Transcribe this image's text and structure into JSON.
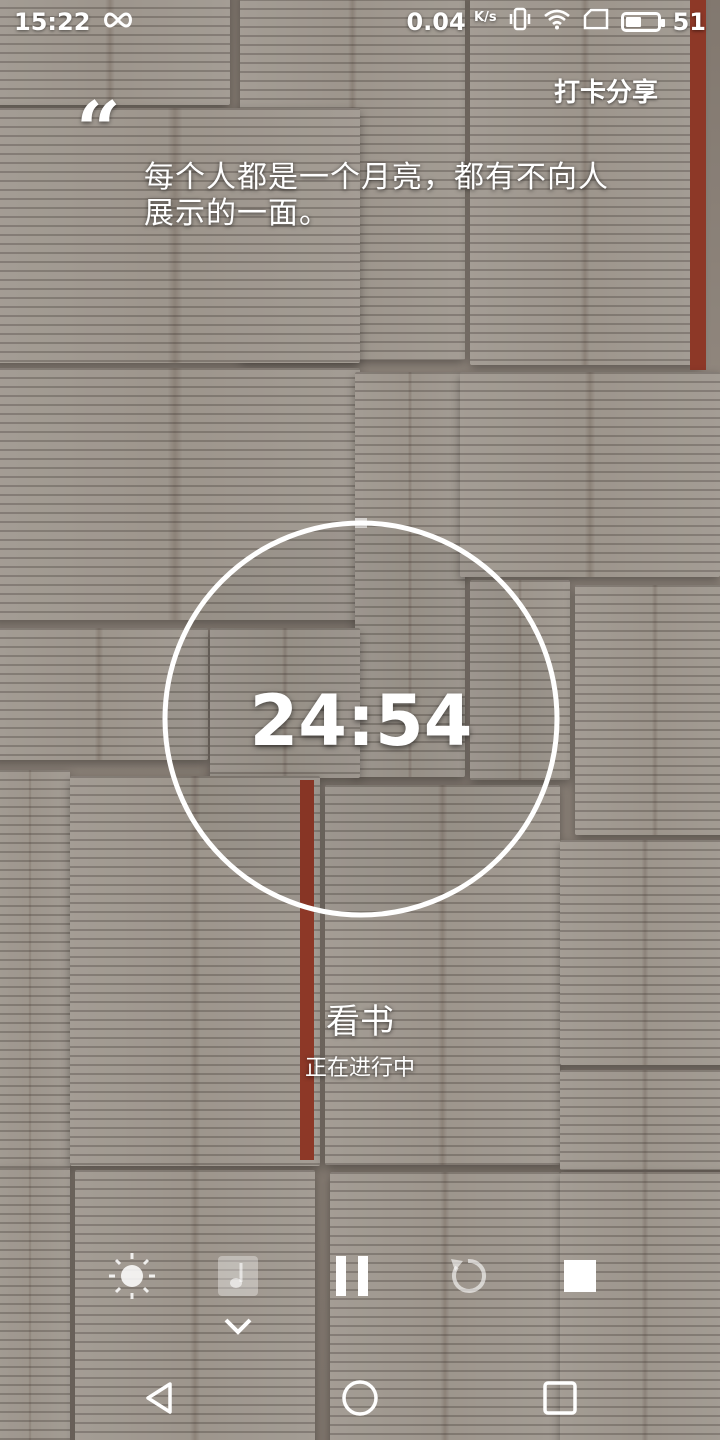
{
  "status_bar": {
    "time": "15:22",
    "infinity_icon": "infinity-icon",
    "network_speed": "0.04",
    "network_unit": "K/s",
    "battery_level": "51",
    "battery_fraction": 0.51
  },
  "header": {
    "share_label": "打卡分享"
  },
  "quote": {
    "mark": "“",
    "text": "每个人都是一个月亮，都有不向人展示的一面。"
  },
  "timer": {
    "time": "24:54",
    "progress_fraction": 0.005
  },
  "task": {
    "name": "看书",
    "status": "正在进行中"
  },
  "controls": {
    "icons": [
      "brightness-icon",
      "music-icon",
      "pause-icon",
      "reset-icon",
      "stop-icon",
      "chevron-down-icon"
    ]
  },
  "navbar": {
    "icons": [
      "back-icon",
      "home-icon",
      "recents-icon"
    ]
  }
}
